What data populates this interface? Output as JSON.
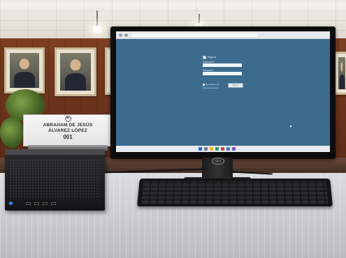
{
  "scene": {
    "nameplate": {
      "line1": "ABRAHAM DE JESÚS",
      "line2": "ÁLVAREZ LÓPEZ",
      "number": "001"
    },
    "monitor": {
      "brand": "DELL",
      "login_page": {
        "brand_label": "Sign in",
        "username_label": "Username",
        "password_label": "Password",
        "remember_label": "Remember me",
        "forgot_label": "Forgot password",
        "button_label": "Sign in"
      }
    }
  }
}
